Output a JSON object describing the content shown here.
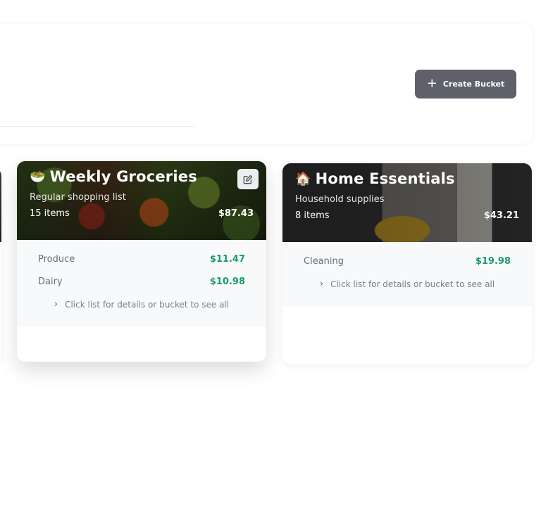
{
  "header": {
    "create_bucket_label": "Create Bucket",
    "create_icon": "plus-icon"
  },
  "buckets": [
    {
      "emoji": "🥗",
      "title": "Weekly Groceries",
      "subtitle": "Regular shopping list",
      "items_count": "15 items",
      "total": "$87.43",
      "edit_icon": "edit-icon",
      "lines": [
        {
          "label": "Produce",
          "amount": "$11.47"
        },
        {
          "label": "Dairy",
          "amount": "$10.98"
        }
      ],
      "hint": "Click list for details or bucket to see all"
    },
    {
      "emoji": "🏠",
      "title": "Home Essentials",
      "subtitle": "Household supplies",
      "items_count": "8 items",
      "total": "$43.21",
      "lines": [
        {
          "label": "Cleaning",
          "amount": "$19.98"
        }
      ],
      "hint": "Click list for details or bucket to see all"
    }
  ],
  "colors": {
    "accent_amount": "#1b9a6a",
    "button_bg": "#5f6069"
  }
}
